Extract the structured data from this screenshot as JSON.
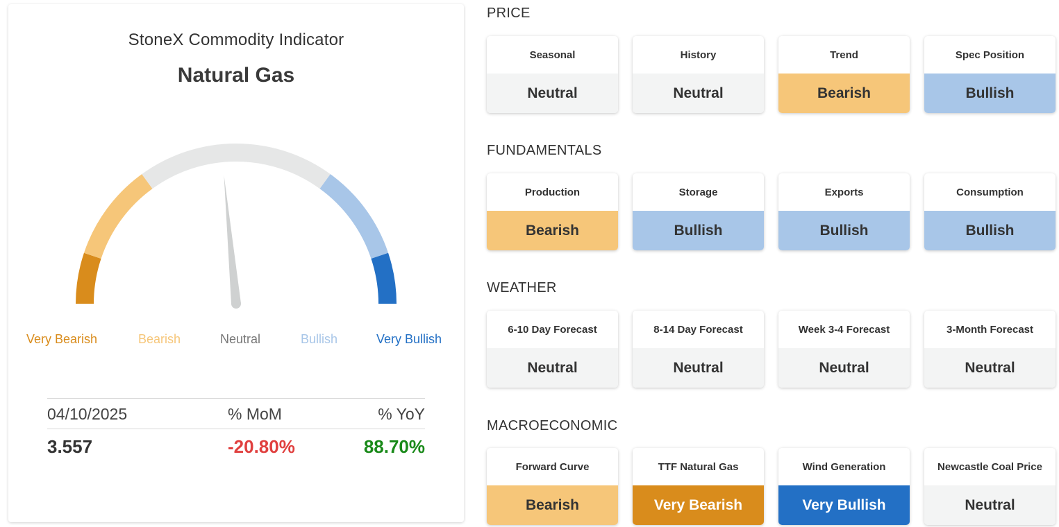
{
  "indicator": {
    "title": "StoneX Commodity Indicator",
    "commodity": "Natural Gas",
    "gauge": {
      "reading": "Neutral",
      "needle_fraction": 0.47,
      "labels": [
        "Very Bearish",
        "Bearish",
        "Neutral",
        "Bullish",
        "Very Bullish"
      ],
      "colors": {
        "very_bearish": "#d98c1c",
        "bearish": "#f6c679",
        "neutral": "#e6e7e7",
        "bullish": "#a8c6e8",
        "very_bullish": "#2370c5",
        "needle": "#cfd1d1"
      }
    },
    "stats": {
      "date": "04/10/2025",
      "mom_label": "% MoM",
      "yoy_label": "% YoY",
      "price": "3.557",
      "mom": "-20.80%",
      "yoy": "88.70%",
      "mom_color": "#e0403f",
      "yoy_color": "#1a8a1a"
    }
  },
  "sections": [
    {
      "title": "PRICE",
      "items": [
        {
          "label": "Seasonal",
          "value": "Neutral"
        },
        {
          "label": "History",
          "value": "Neutral"
        },
        {
          "label": "Trend",
          "value": "Bearish"
        },
        {
          "label": "Spec Position",
          "value": "Bullish"
        }
      ]
    },
    {
      "title": "FUNDAMENTALS",
      "items": [
        {
          "label": "Production",
          "value": "Bearish"
        },
        {
          "label": "Storage",
          "value": "Bullish"
        },
        {
          "label": "Exports",
          "value": "Bullish"
        },
        {
          "label": "Consumption",
          "value": "Bullish"
        }
      ]
    },
    {
      "title": "WEATHER",
      "items": [
        {
          "label": "6-10 Day Forecast",
          "value": "Neutral"
        },
        {
          "label": "8-14 Day Forecast",
          "value": "Neutral"
        },
        {
          "label": "Week 3-4 Forecast",
          "value": "Neutral"
        },
        {
          "label": "3-Month Forecast",
          "value": "Neutral"
        }
      ]
    },
    {
      "title": "MACROECONOMIC",
      "items": [
        {
          "label": "Forward Curve",
          "value": "Bearish"
        },
        {
          "label": "TTF Natural Gas",
          "value": "Very Bearish"
        },
        {
          "label": "Wind Generation",
          "value": "Very Bullish"
        },
        {
          "label": "Newcastle Coal Price",
          "value": "Neutral"
        }
      ]
    }
  ]
}
